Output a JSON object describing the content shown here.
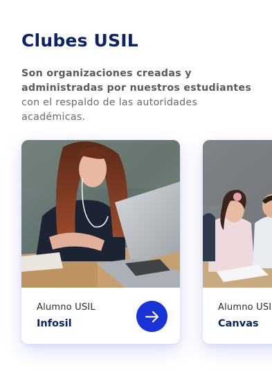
{
  "section": {
    "title": "Clubes USIL",
    "intro_bold": "Son organizaciones creadas y administradas por nuestros estudiantes",
    "intro_rest": " con el respaldo de las autoridades académicas."
  },
  "cards": [
    {
      "kicker": "Alumno USIL",
      "name": "Infosil",
      "icon": "arrow-right-icon"
    },
    {
      "kicker": "Alumno USIL",
      "name": "Canvas"
    }
  ],
  "colors": {
    "heading": "#0a2363",
    "accent": "#1a33d6",
    "body_text": "#6b6b6b"
  }
}
